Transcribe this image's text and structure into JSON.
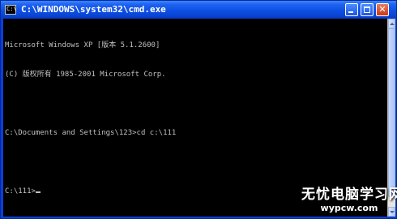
{
  "window": {
    "title": "C:\\WINDOWS\\system32\\cmd.exe",
    "icon": "console-icon",
    "icon_text": "C:\\",
    "buttons": {
      "minimize_icon": "minimize-icon",
      "maximize_icon": "maximize-icon",
      "close_icon": "close-icon",
      "close_glyph": "✕"
    }
  },
  "console": {
    "lines": [
      "Microsoft Windows XP [版本 5.1.2600]",
      "(C) 版权所有 1985-2001 Microsoft Corp.",
      "",
      "C:\\Documents and Settings\\123>cd c:\\111",
      "",
      "C:\\111>"
    ],
    "text_color": "#c0c0c0",
    "background_color": "#000000"
  },
  "watermark": {
    "line1": "无忧电脑学习网",
    "line2": "wypcw.com"
  },
  "colors": {
    "titlebar": "#0d4fe4",
    "frame": "#0b3fd6",
    "close_button": "#c8391c"
  }
}
